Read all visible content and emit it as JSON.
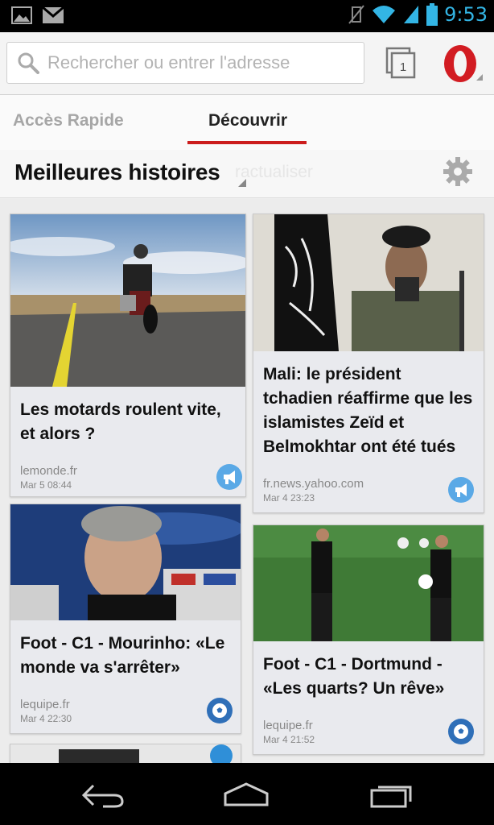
{
  "status_bar": {
    "time": "9:53"
  },
  "url_bar": {
    "placeholder": "Rechercher ou entrer l'adresse",
    "tab_count": "1"
  },
  "top_nav": {
    "tabs": [
      {
        "label": "Accès Rapide",
        "active": false
      },
      {
        "label": "Découvrir",
        "active": true
      }
    ]
  },
  "section": {
    "title": "Meilleures histoires",
    "ghost_text": "ractualiser"
  },
  "cards": [
    {
      "title": "Les motards roulent vite, et alors ?",
      "source": "lemonde.fr",
      "date": "Mar 5 08:44",
      "badge_icon": "megaphone-icon"
    },
    {
      "title": "Mali: le président tchadien réaffirme que les islamistes Zeïd et Belmokhtar ont été tués",
      "source": "fr.news.yahoo.com",
      "date": "Mar 4 23:23",
      "badge_icon": "megaphone-icon"
    },
    {
      "title": "Foot - C1 - Mourinho: «Le monde va s'arrêter»",
      "source": "lequipe.fr",
      "date": "Mar 4 22:30",
      "badge_icon": "soccer-ball-icon"
    },
    {
      "title": "Foot - C1 - Dortmund - «Les quarts? Un rêve»",
      "source": "lequipe.fr",
      "date": "Mar 4 21:52",
      "badge_icon": "soccer-ball-icon"
    }
  ],
  "colors": {
    "accent_red": "#cc1d1d",
    "status_blue": "#33b5e5",
    "badge_blue": "#5aa9e6"
  }
}
